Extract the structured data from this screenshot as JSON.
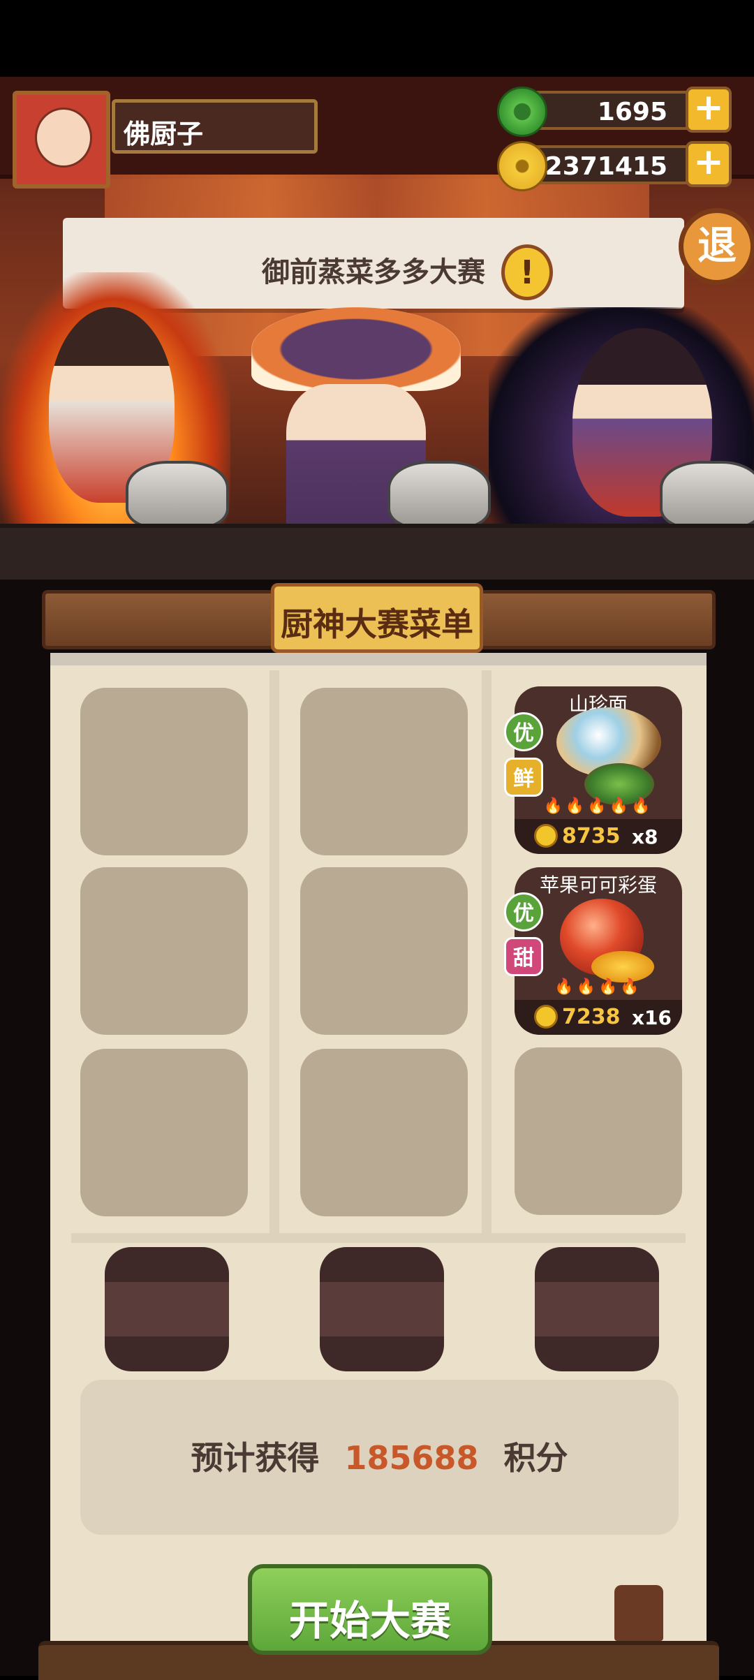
{
  "player": {
    "name": "佛厨子"
  },
  "currencies": [
    {
      "id": "jade",
      "icon": "jade-coin-icon",
      "value": "1695"
    },
    {
      "id": "gold",
      "icon": "gold-coin-icon",
      "value": "2371415"
    }
  ],
  "buttons": {
    "add": "+",
    "exit": "退",
    "start": "开始大赛"
  },
  "scene": {
    "banner_text": "御前蒸菜多多大赛",
    "alert": "!"
  },
  "board": {
    "title": "厨神大赛菜单"
  },
  "dishes": [
    {
      "name": "山珍面",
      "tags": [
        "优",
        "鲜"
      ],
      "price": "8735",
      "qty": "x8",
      "flames": "🔥🔥🔥🔥🔥"
    },
    {
      "name": "苹果可可彩蛋",
      "tags": [
        "优",
        "甜"
      ],
      "price": "7238",
      "qty": "x16",
      "flames": "🔥🔥🔥🔥"
    }
  ],
  "score": {
    "prefix": "预计获得",
    "value": "185688",
    "suffix": "积分"
  },
  "colors": {
    "score_value": "#c8582a",
    "start_button": "#6fba45",
    "tag_green": "#5aa23a",
    "tag_yellow": "#e6b02b",
    "tag_pink": "#d2477a"
  }
}
